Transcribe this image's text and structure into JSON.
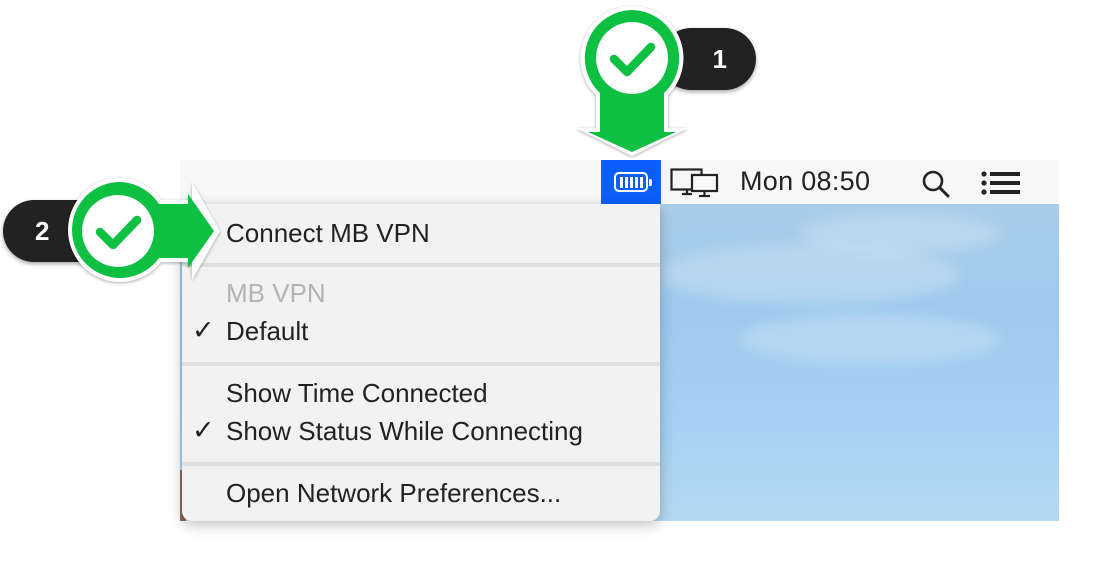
{
  "menubar": {
    "clock": "Mon 08:50",
    "status_items": [
      {
        "name": "vpn-status-item",
        "icon": "battery-icon",
        "active_color": "#0a5ffb"
      },
      {
        "name": "displays-menu",
        "icon": "display-icon"
      },
      {
        "name": "spotlight",
        "icon": "search-icon"
      },
      {
        "name": "notification-center",
        "icon": "list-icon"
      }
    ]
  },
  "menu": {
    "connect": "Connect MB VPN",
    "section_header": "MB VPN",
    "default_config": "Default",
    "show_time": "Show Time Connected",
    "show_status": "Show Status While Connecting",
    "open_prefs": "Open Network Preferences...",
    "checkmark": "✓"
  },
  "callouts": {
    "step1": "1",
    "step2": "2",
    "accent_color": "#00c040",
    "badge_color": "#222222"
  }
}
